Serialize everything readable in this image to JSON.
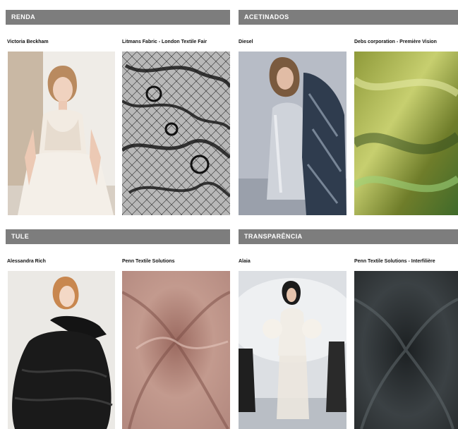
{
  "sections": [
    {
      "title": "RENDA",
      "items": [
        {
          "caption": "Victoria Beckham",
          "image": "model-in-ivory-lace-slip-dress"
        },
        {
          "caption": "Litmans Fabric - London Textile Fair",
          "image": "black-lace-fabric-swatch"
        }
      ]
    },
    {
      "title": "ACETINADOS",
      "items": [
        {
          "caption": "Diesel",
          "image": "model-in-silver-satin-slip-dress"
        },
        {
          "caption": "Debs corporation - Première Vision",
          "image": "green-satin-fabric-swatch"
        }
      ]
    },
    {
      "title": "TULE",
      "items": [
        {
          "caption": "Alessandra Rich",
          "image": "model-in-black-tulle-dress"
        },
        {
          "caption": "Penn Textile Solutions",
          "image": "rose-tulle-fabric-swatch"
        }
      ]
    },
    {
      "title": "TRANSPARÊNCIA",
      "items": [
        {
          "caption": "Alaia",
          "image": "runway-model-in-sheer-white-look"
        },
        {
          "caption": "Penn Textile Solutions - Interfilière",
          "image": "black-sheer-fabric-swatch"
        }
      ]
    }
  ],
  "colors": {
    "header_bg": "#7d7d7d",
    "header_text": "#ffffff"
  }
}
